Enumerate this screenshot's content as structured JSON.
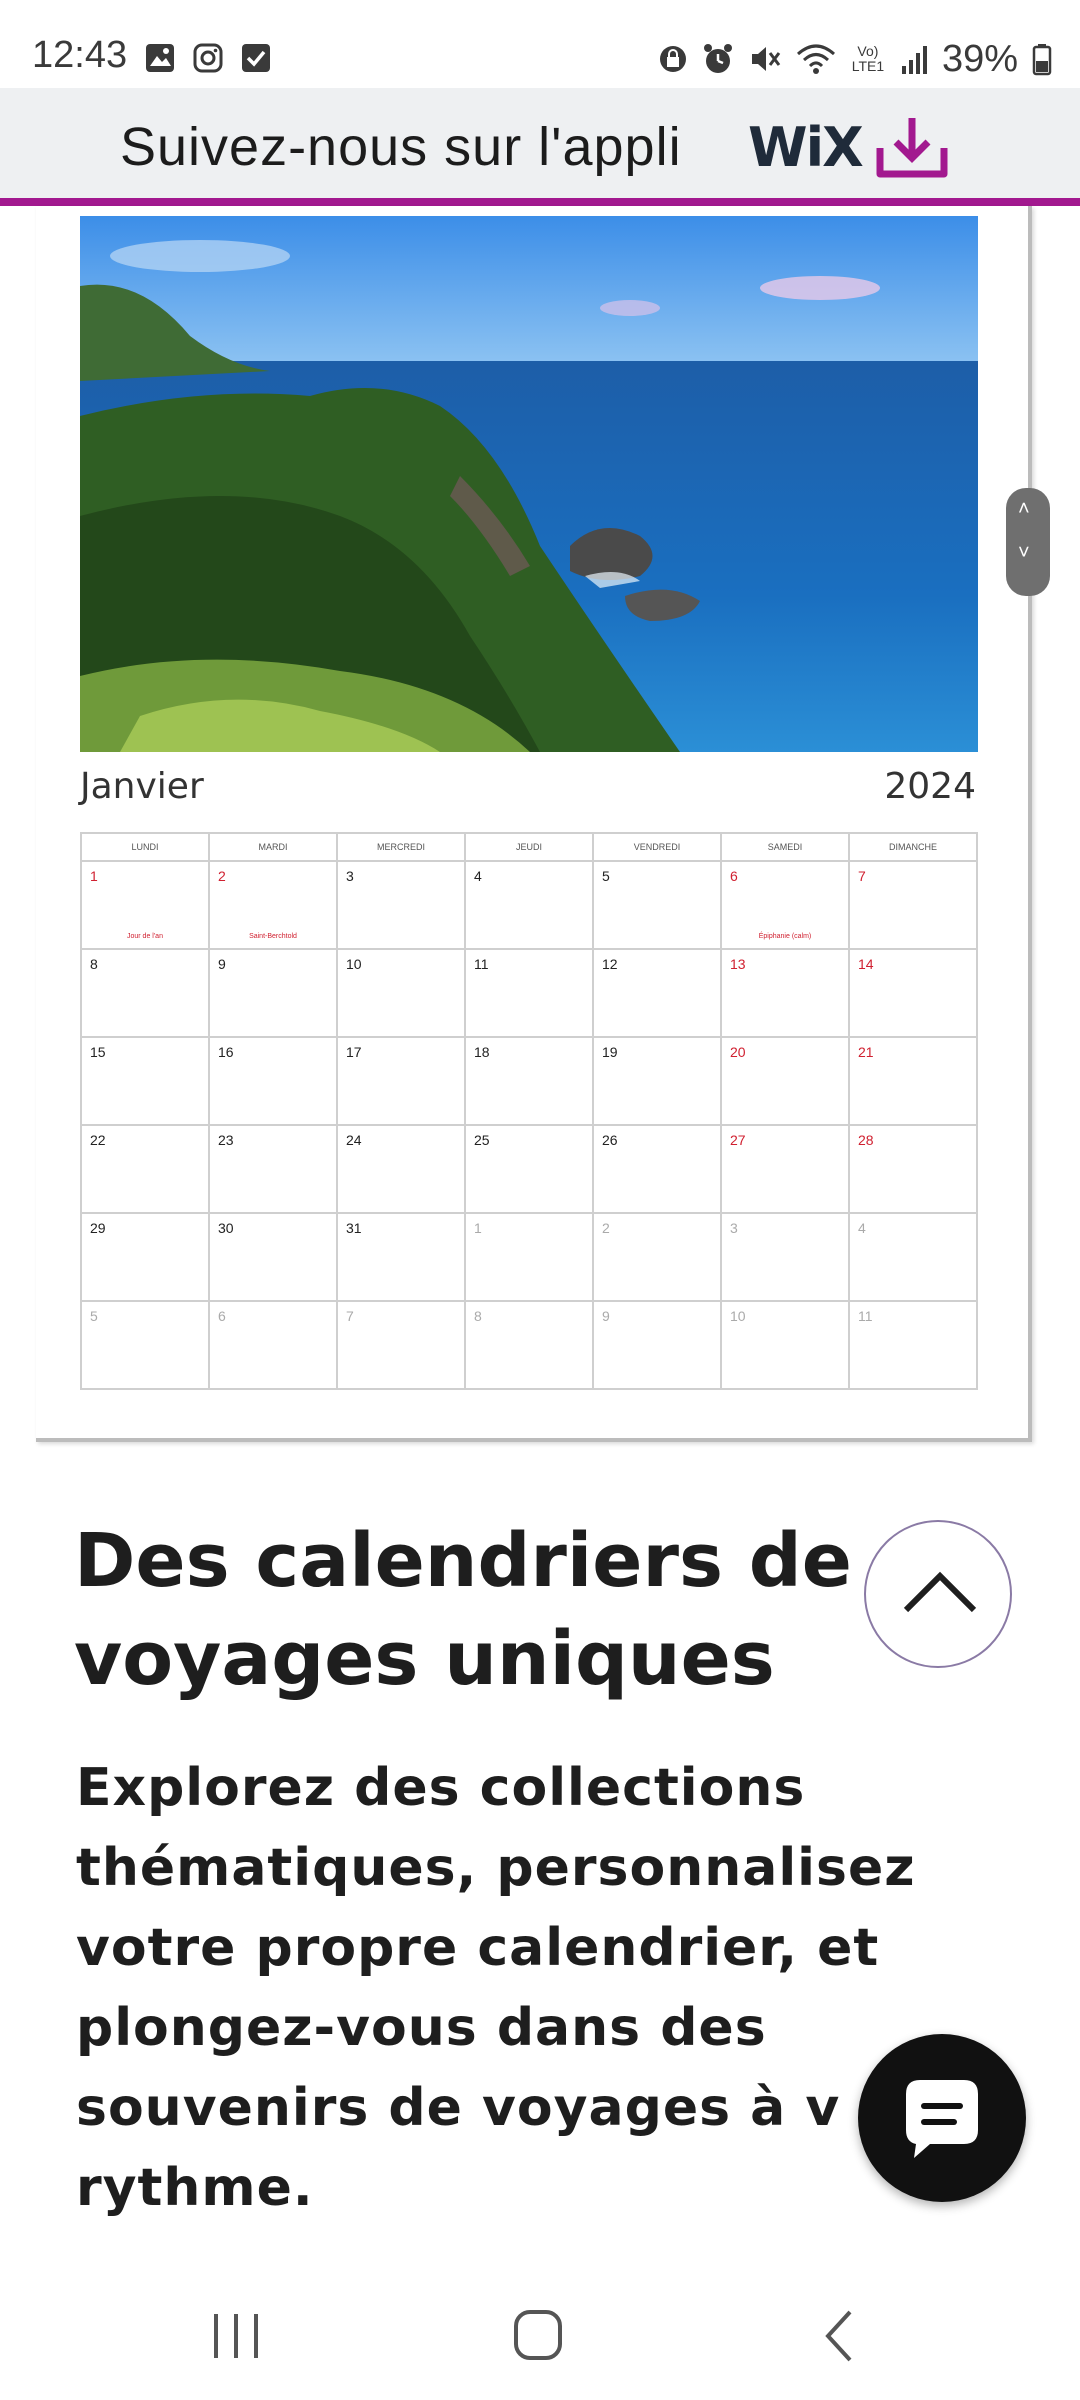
{
  "status_bar": {
    "time": "12:43",
    "battery": "39%",
    "network_label": "Vo) LTE1"
  },
  "wix_banner": {
    "text": "Suivez-nous sur l'appli",
    "logo_text": "WiX",
    "accent_color": "#a2198f"
  },
  "calendar": {
    "month": "Janvier",
    "year": "2024",
    "weekdays": [
      "Lundi",
      "Mardi",
      "Mercredi",
      "Jeudi",
      "Vendredi",
      "Samedi",
      "Dimanche"
    ],
    "weeks": [
      [
        {
          "d": "1",
          "t": "we",
          "note": "Jour de l'an"
        },
        {
          "d": "2",
          "t": "we",
          "note": "Saint-Berchtold"
        },
        {
          "d": "3",
          "t": ""
        },
        {
          "d": "4",
          "t": ""
        },
        {
          "d": "5",
          "t": ""
        },
        {
          "d": "6",
          "t": "we",
          "note": "Épiphanie (calm)"
        },
        {
          "d": "7",
          "t": "we"
        }
      ],
      [
        {
          "d": "8",
          "t": ""
        },
        {
          "d": "9",
          "t": ""
        },
        {
          "d": "10",
          "t": ""
        },
        {
          "d": "11",
          "t": ""
        },
        {
          "d": "12",
          "t": ""
        },
        {
          "d": "13",
          "t": "we"
        },
        {
          "d": "14",
          "t": "we"
        }
      ],
      [
        {
          "d": "15",
          "t": ""
        },
        {
          "d": "16",
          "t": ""
        },
        {
          "d": "17",
          "t": ""
        },
        {
          "d": "18",
          "t": ""
        },
        {
          "d": "19",
          "t": ""
        },
        {
          "d": "20",
          "t": "we"
        },
        {
          "d": "21",
          "t": "we"
        }
      ],
      [
        {
          "d": "22",
          "t": ""
        },
        {
          "d": "23",
          "t": ""
        },
        {
          "d": "24",
          "t": ""
        },
        {
          "d": "25",
          "t": ""
        },
        {
          "d": "26",
          "t": ""
        },
        {
          "d": "27",
          "t": "we"
        },
        {
          "d": "28",
          "t": "we"
        }
      ],
      [
        {
          "d": "29",
          "t": ""
        },
        {
          "d": "30",
          "t": ""
        },
        {
          "d": "31",
          "t": ""
        },
        {
          "d": "1",
          "t": "other"
        },
        {
          "d": "2",
          "t": "other"
        },
        {
          "d": "3",
          "t": "other"
        },
        {
          "d": "4",
          "t": "other"
        }
      ],
      [
        {
          "d": "5",
          "t": "other"
        },
        {
          "d": "6",
          "t": "other"
        },
        {
          "d": "7",
          "t": "other"
        },
        {
          "d": "8",
          "t": "other"
        },
        {
          "d": "9",
          "t": "other"
        },
        {
          "d": "10",
          "t": "other"
        },
        {
          "d": "11",
          "t": "other"
        }
      ]
    ]
  },
  "content": {
    "heading": "Des calendriers de voyages uniques",
    "body": "Explorez des collections thématiques, personnalisez votre propre calendrier, et plongez-vous dans des souvenirs de voyages à v rythme."
  },
  "colors": {
    "accent": "#a2198f",
    "weekend_red": "#d02030",
    "chat_button": "#111111"
  },
  "icons": {
    "status": [
      "gallery-icon",
      "instagram-icon",
      "check-square-icon",
      "lock-icon",
      "alarm-icon",
      "mute-icon",
      "wifi-icon",
      "signal-icon",
      "battery-icon"
    ],
    "banner": "download-icon",
    "nav": [
      "recent-apps-icon",
      "home-icon",
      "back-icon"
    ]
  }
}
